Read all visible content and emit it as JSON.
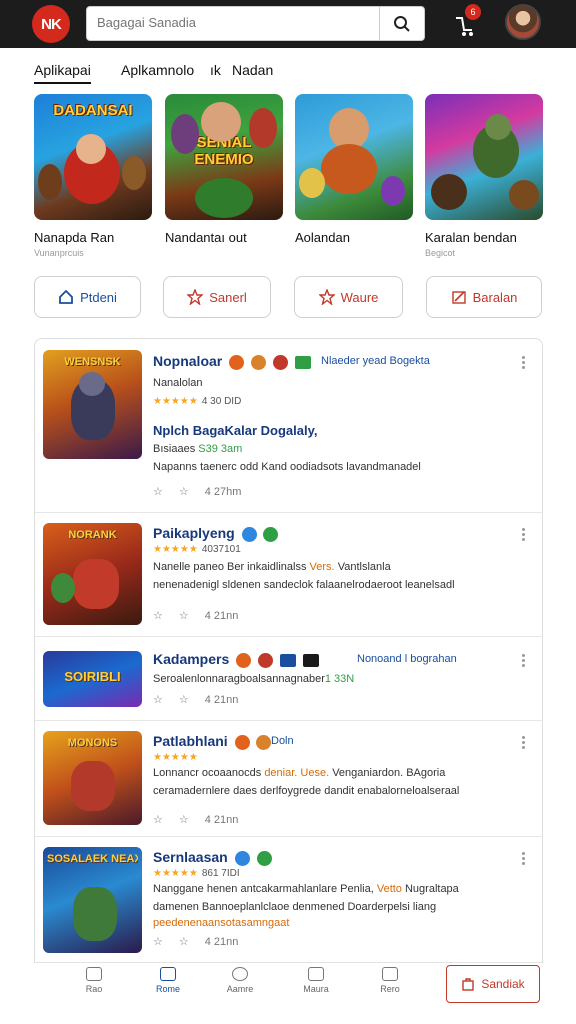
{
  "header": {
    "logo_text": "NK",
    "search_placeholder": "Bagagai Sanadia",
    "notification_count": "6"
  },
  "tabs": [
    {
      "label": "Aplikapai"
    },
    {
      "label": "Aplkamnolo"
    },
    {
      "label": "ık"
    },
    {
      "label": "Nadan"
    }
  ],
  "featured": [
    {
      "art_text": "DADANSAI",
      "title": "Nanapda Ran",
      "subtitle": "Vunanprcuis"
    },
    {
      "art_text": "SENIAL ENEMIO",
      "title": "Nandantaı out",
      "subtitle": ""
    },
    {
      "art_text": "",
      "title": "Aolandan",
      "subtitle": ""
    },
    {
      "art_text": "",
      "title": "Karalan bendan",
      "subtitle": "Begicot"
    }
  ],
  "actions": [
    {
      "label": "Ptdeni",
      "icon": "home-icon"
    },
    {
      "label": "Sanerl",
      "icon": "star-icon"
    },
    {
      "label": "Waure",
      "icon": "star-icon"
    },
    {
      "label": "Baralan",
      "icon": "edit-icon"
    }
  ],
  "items": [
    {
      "art_text": "WENSNSK",
      "name": "Nopnaloar",
      "extra": "Nlaeder yead Bogekta",
      "line1": "Nanalolan",
      "rating_text": "4 30 DID",
      "subtitle": "Nplch BagaKalar Dogalaly,",
      "line2a": "Bısiaaes",
      "line2b": "S39 3am",
      "line3": "Napanns taenerc odd Kand oodiadsots lavandmanadel",
      "time": "4 27hm"
    },
    {
      "art_text": "NORANK",
      "name": "Paikaplyeng",
      "rating_text": "4037101",
      "line1a": "Nanelle paneo Ber inkaidlinalss",
      "line1b": "Vers.",
      "line1c": "Vantlslanla",
      "line2": "nenenadenigl sldenen sandeclok falaanelrodaeroot leanelsadl",
      "time": "4 21nn"
    },
    {
      "art_text": "SOIRIBLI",
      "name": "Kadampers",
      "extra": "Nonoand l bograhan",
      "line1a": "Seroalenlonnaragboalsannagnaber",
      "line1b": "1 33N",
      "time": "4 21nn"
    },
    {
      "art_text": "MONONS",
      "name": "Patlabhlani",
      "extra": "Doln",
      "rating_text": "",
      "line1a": "Lonnancr ocoaanocds",
      "line1b": "deniar. Uese.",
      "line1c": "Venganiardon. BAgoria",
      "line2": "ceramadernlere daes derlfoygrede dandit enabalorneloalseraal",
      "time": "4 21nn"
    },
    {
      "art_text": "SOSALAEK NEAX",
      "name": "Sernlaasan",
      "rating_text": "861 7IDI",
      "line1a": "Nanggane henen antcakarmahlanlare Penlia,",
      "line1b": "Vetto",
      "line1c": "Nugraltapa",
      "line2": "damenen Bannoeplanlclaoe denmened Doarderpelsi liang",
      "line3": "peedenenaansotasamngaat",
      "time": "4 21nn"
    }
  ],
  "bottom_nav": [
    {
      "label": "Rao"
    },
    {
      "label": "Rome"
    },
    {
      "label": "Aamre"
    },
    {
      "label": "Maura"
    },
    {
      "label": "Rero"
    }
  ],
  "bottom_cta": "Sandiak",
  "colors": {
    "brand_red": "#d42a1e",
    "link_blue": "#17387a",
    "star": "#f5a623"
  }
}
